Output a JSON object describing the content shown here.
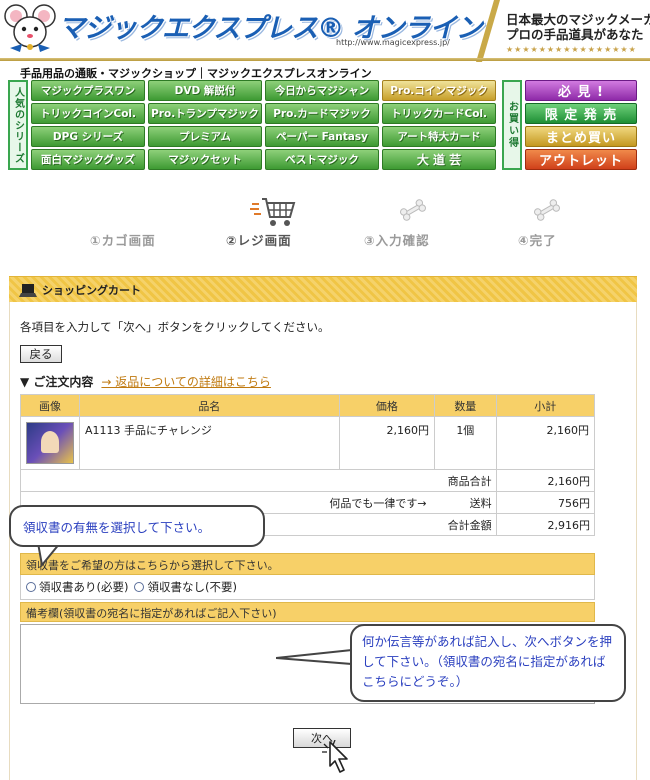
{
  "header": {
    "logo_text": "マジックエクスプレス® オンライン",
    "logo_url": "http://www.magicexpress.jp/",
    "tagline_line1": "日本最大のマジックメーカ",
    "tagline_line2": "プロの手品道具があなた",
    "tagline_stars": "★★★★★★★★★★★★★★★★",
    "brand_color": "#1a5fb4"
  },
  "nav": {
    "site_description": "手品用品の通販・マジックショップ｜マジックエクスプレスオンライン",
    "series_label": "人気のシリーズ",
    "buy_label": "お買い得",
    "items": [
      {
        "label": "マジックプラスワン",
        "style": "green"
      },
      {
        "label": "DVD 解説付",
        "style": "green"
      },
      {
        "label": "今日からマジシャン",
        "style": "green"
      },
      {
        "label": "Pro.コインマジック",
        "style": "gold"
      },
      {
        "label": "トリックコインCol.",
        "style": "green"
      },
      {
        "label": "Pro.トランプマジック",
        "style": "green"
      },
      {
        "label": "Pro.カードマジック",
        "style": "green"
      },
      {
        "label": "トリックカードCol.",
        "style": "green"
      },
      {
        "label": "DPG シリーズ",
        "style": "green"
      },
      {
        "label": "プレミアム",
        "style": "green"
      },
      {
        "label": "ペーパー Fantasy",
        "style": "green"
      },
      {
        "label": "アート特大カード",
        "style": "green"
      },
      {
        "label": "面白マジックグッズ",
        "style": "green"
      },
      {
        "label": "マジックセット",
        "style": "green"
      },
      {
        "label": "ベストマジック",
        "style": "green"
      },
      {
        "label": "大 道 芸",
        "style": "green"
      }
    ],
    "promos": [
      {
        "label": "必 見 !",
        "style": "purple"
      },
      {
        "label": "限 定 発 売",
        "style": "green"
      },
      {
        "label": "まとめ買い",
        "style": "gold"
      },
      {
        "label": "アウトレット",
        "style": "red"
      }
    ]
  },
  "steps": {
    "step1": "①カゴ画面",
    "step2": "②レジ画面",
    "step3": "③入力確認",
    "step4": "④完了",
    "active_step": 2
  },
  "panel": {
    "title": "ショッピングカート",
    "instruction": "各項目を入力して「次へ」ボタンをクリックしてください。",
    "back_label": "戻る",
    "order_heading": "▼ ご注文内容",
    "return_link": "→ 返品についての詳細はこちら"
  },
  "table": {
    "headers": [
      "画像",
      "品名",
      "価格",
      "数量",
      "小計"
    ],
    "product": {
      "name": "A1113 手品にチャレンジ",
      "price": "2,160円",
      "qty": "1個",
      "subtotal": "2,160円"
    },
    "goods_total_label": "商品合計",
    "goods_total": "2,160円",
    "shipping_note": "何品でも一律です→",
    "shipping_label": "送料",
    "shipping": "756円",
    "grand_total_label": "合計金額",
    "grand_total": "2,916円"
  },
  "receipt": {
    "heading": "領収書をご希望の方はこちらから選択して下さい。",
    "option_yes": "領収書あり(必要)",
    "option_no": "領収書なし(不要)"
  },
  "memo": {
    "heading": "備考欄(領収書の宛名に指定があればご記入下さい)",
    "value": ""
  },
  "next_label": "次へ",
  "callouts": {
    "receipt_hint": "領収書の有無を選択して下さい。",
    "memo_hint": "何か伝言等があれば記入し、次へボタンを押して下さい。（領収書の宛名に指定があればこちらにどうぞ。）"
  }
}
